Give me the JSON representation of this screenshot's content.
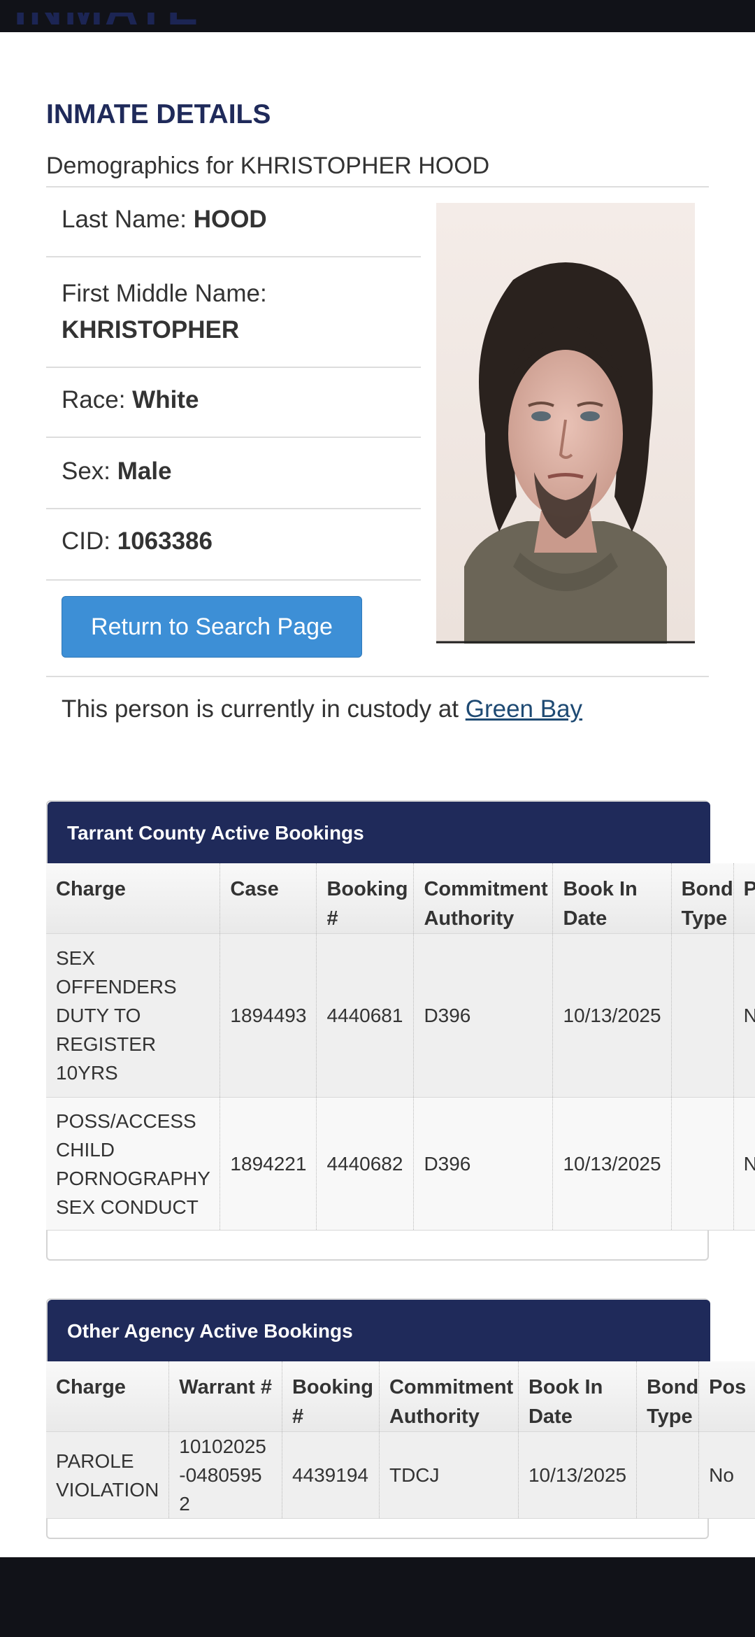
{
  "page": {
    "top_title_cut": "INMATE SEARCH",
    "heading": "INMATE DETAILS",
    "demographics_prefix": "Demographics for",
    "demographics_name": "KHRISTOPHER HOOD"
  },
  "demographics": {
    "last_name_label": "Last Name:",
    "last_name": "HOOD",
    "first_middle_label": "First Middle Name:",
    "first_middle": "KHRISTOPHER",
    "race_label": "Race:",
    "race": "White",
    "sex_label": "Sex:",
    "sex": "Male",
    "cid_label": "CID:",
    "cid": "1063386"
  },
  "actions": {
    "return_label": "Return to Search Page"
  },
  "custody": {
    "text": "This person is currently in custody at",
    "location": "Green Bay"
  },
  "tarrant": {
    "title": "Tarrant County Active Bookings",
    "headers": [
      "Charge",
      "Case",
      "Booking #",
      "Commitment Authority",
      "Book In Date",
      "Bond Type",
      "P"
    ],
    "rows": [
      [
        "SEX OFFENDERS DUTY TO REGISTER 10YRS",
        "1894493",
        "4440681",
        "D396",
        "10/13/2025",
        "",
        "N"
      ],
      [
        "POSS/ACCESS CHILD PORNOGRAPHY SEX CONDUCT",
        "1894221",
        "4440682",
        "D396",
        "10/13/2025",
        "",
        "N"
      ]
    ]
  },
  "other": {
    "title": "Other Agency Active Bookings",
    "headers": [
      "Charge",
      "Warrant #",
      "Booking #",
      "Commitment Authority",
      "Book In Date",
      "Bond Type",
      "Pos"
    ],
    "rows": [
      [
        "PAROLE VIOLATION",
        "10102025-04805952",
        "4439194",
        "TDCJ",
        "10/13/2025",
        "",
        "No"
      ]
    ]
  },
  "colors": {
    "navy": "#1f2a5a",
    "button": "#3d8fd6",
    "link": "#1e4a73"
  }
}
